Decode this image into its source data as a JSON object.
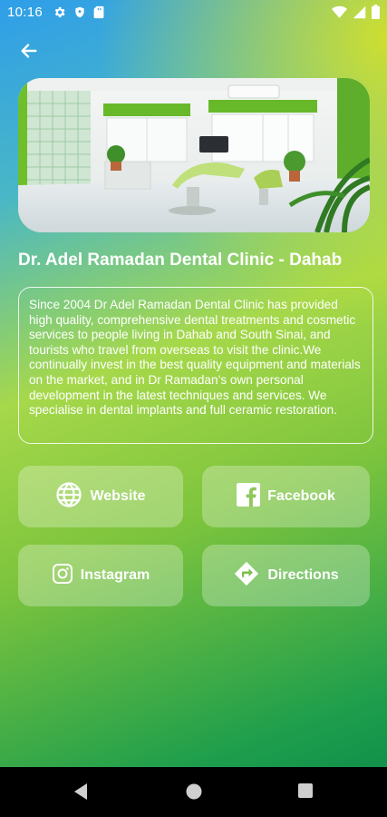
{
  "status_bar": {
    "time": "10:16",
    "left_icons": [
      "gear-icon",
      "shield-icon",
      "sd-card-icon"
    ],
    "right_icons": [
      "wifi-icon",
      "signal-icon",
      "battery-icon"
    ]
  },
  "header": {
    "back_icon": "arrow-left-icon"
  },
  "clinic": {
    "title": "Dr. Adel Ramadan Dental Clinic - Dahab",
    "description": "Since 2004 Dr Adel Ramadan Dental Clinic has provided high quality, comprehensive dental treatments and cosmetic services to people living in Dahab and South Sinai, and tourists who travel from overseas to visit the clinic.We continually invest in the best quality equipment and materials on the market, and in Dr Ramadan’s own personal development in the latest techniques and services. We specialise in dental implants and full ceramic restoration."
  },
  "actions": {
    "website": "Website",
    "facebook": "Facebook",
    "instagram": "Instagram",
    "directions": "Directions"
  },
  "nav": [
    "back-triangle-icon",
    "home-circle-icon",
    "recents-square-icon"
  ]
}
